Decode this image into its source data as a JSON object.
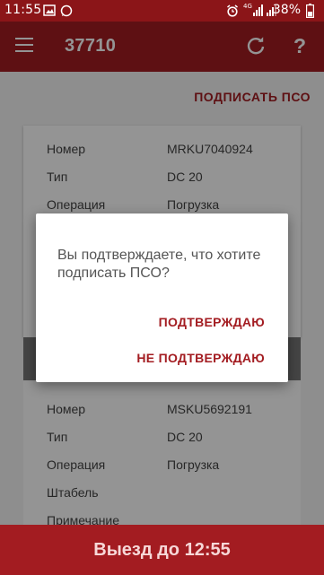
{
  "status_bar": {
    "time": "11:55",
    "network_label": "4G",
    "battery_percent": "38%",
    "icons": [
      "image-icon",
      "whatsapp-icon",
      "alarm-icon",
      "signal-icon",
      "signal-icon",
      "battery-icon"
    ]
  },
  "app_bar": {
    "title": "37710",
    "icons": [
      "menu-icon",
      "refresh-icon",
      "help-icon"
    ],
    "help_glyph": "?"
  },
  "action_bar": {
    "sign_label": "ПОДПИСАТЬ ПСО"
  },
  "cards": [
    {
      "rows": [
        {
          "label": "Номер",
          "value": "MRKU7040924"
        },
        {
          "label": "Тип",
          "value": "DC 20"
        },
        {
          "label": "Операция",
          "value": "Погрузка"
        }
      ]
    },
    {
      "rows": [
        {
          "label": "Номер",
          "value": "MSKU5692191"
        },
        {
          "label": "Тип",
          "value": "DC 20"
        },
        {
          "label": "Операция",
          "value": "Погрузка"
        },
        {
          "label": "Штабель",
          "value": ""
        },
        {
          "label": "Примечание",
          "value": ""
        }
      ]
    }
  ],
  "dialog": {
    "message": "Вы подтверждаете, что хотите подписать ПСО?",
    "confirm_label": "ПОДТВЕРЖДАЮ",
    "decline_label": "НЕ ПОДТВЕРЖДАЮ"
  },
  "departure": {
    "label": "Выезд до 12:55"
  },
  "colors": {
    "status_bar": "#8b1518",
    "primary": "#a31c21",
    "accent_text": "#a31c21",
    "card_header_grey": "#777777"
  }
}
